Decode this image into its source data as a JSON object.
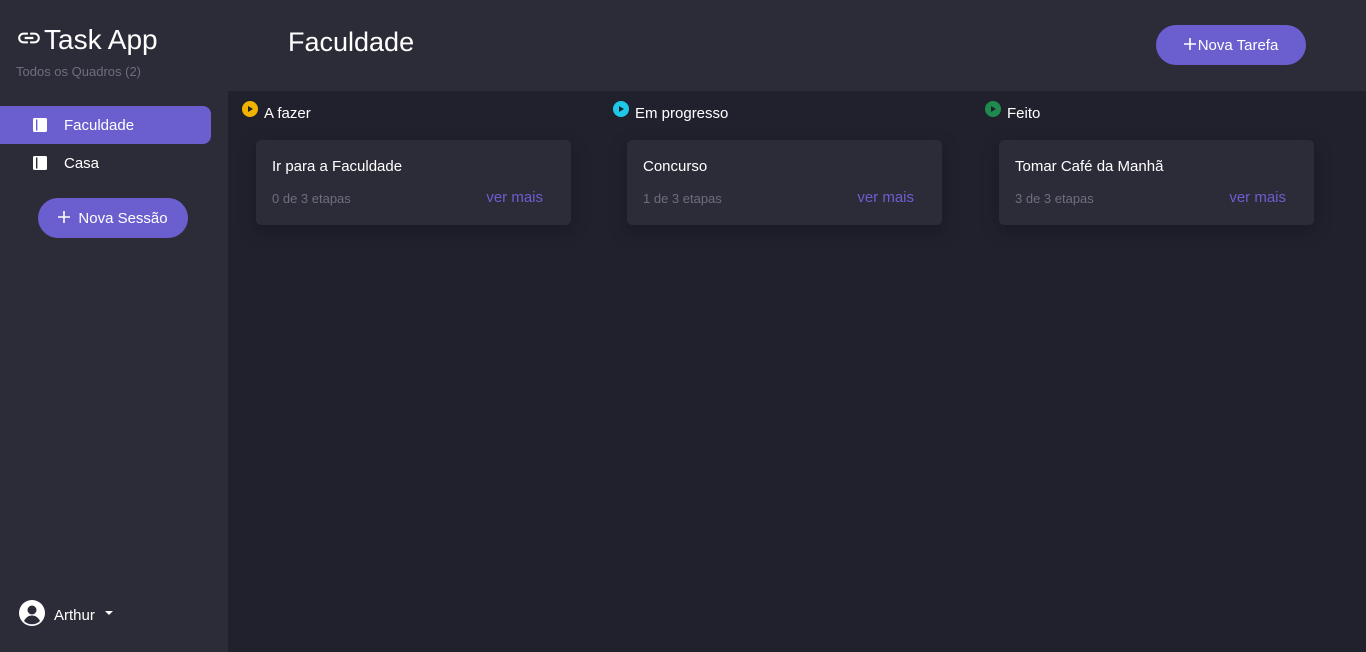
{
  "brand": {
    "title": "Task App",
    "subtitle": "Todos os Quadros (2)",
    "icon": "link-icon"
  },
  "sidebar": {
    "items": [
      {
        "label": "Faculdade",
        "icon": "book-icon",
        "active": true
      },
      {
        "label": "Casa",
        "icon": "book-icon",
        "active": false
      }
    ],
    "new_session_label": "Nova Sessão"
  },
  "user": {
    "name": "Arthur",
    "icon": "account-circle-icon"
  },
  "header": {
    "title": "Faculdade",
    "new_task_label": "Nova Tarefa"
  },
  "columns": [
    {
      "title": "A fazer",
      "color": "#f0b400",
      "cards": [
        {
          "title": "Ir para a Faculdade",
          "steps": "0 de 3 etapas",
          "more": "ver mais"
        }
      ]
    },
    {
      "title": "Em progresso",
      "color": "#1ec8e8",
      "cards": [
        {
          "title": "Concurso",
          "steps": "1 de 3 etapas",
          "more": "ver mais"
        }
      ]
    },
    {
      "title": "Feito",
      "color": "#1f8a4d",
      "cards": [
        {
          "title": "Tomar Café da Manhã",
          "steps": "3 de 3 etapas",
          "more": "ver mais"
        }
      ]
    }
  ],
  "colors": {
    "accent": "#6b5fd0",
    "sidebar_bg": "#2c2b38",
    "main_bg": "#21212d"
  }
}
